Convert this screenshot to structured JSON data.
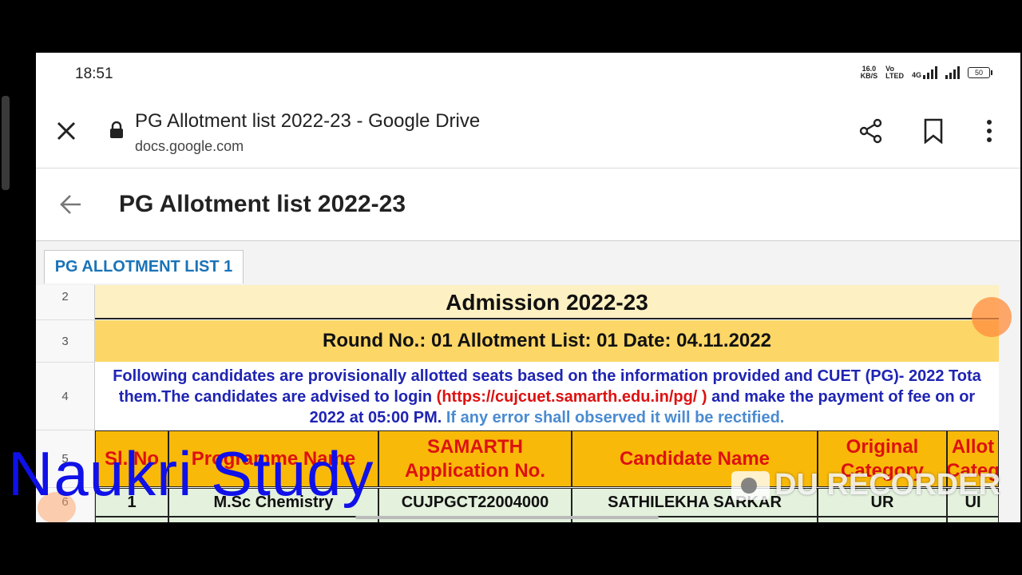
{
  "status_bar": {
    "time": "18:51",
    "speed_value": "16.0",
    "speed_unit": "KB/S",
    "volte_top": "Vo",
    "volte_bottom": "LTED",
    "network": "4G",
    "battery": "50"
  },
  "toolbar": {
    "title": "PG Allotment list 2022-23 - Google Drive",
    "url": "docs.google.com",
    "icons": [
      "close-icon",
      "lock-icon",
      "share-icon",
      "bookmark-icon",
      "more-vert-icon"
    ]
  },
  "doc_header": {
    "title": "PG Allotment list 2022-23",
    "back_icon": "arrow-back-icon"
  },
  "sheet": {
    "tab_label": "PG ALLOTMENT LIST 1",
    "row_numbers": [
      "2",
      "3",
      "4",
      "5",
      "6"
    ],
    "admission": "Admission 2022-23",
    "round": "Round No.: 01 Allotment List: 01 Date: 04.11.2022",
    "notice_line1": "Following candidates are provisionally allotted seats based on the information provided and CUET (PG)- 2022 Tota",
    "notice_line2_a": "them.The candidates are advised to login",
    "notice_line2_link": "(https://cujcuet.samarth.edu.in/pg/ )",
    "notice_line2_b": "and make the payment of fee on or",
    "notice_line3_a": "2022 at 05:00 PM.",
    "notice_line3_b": "If any error shall observed it will be rectified.",
    "headers": [
      "Sl. No",
      "Programme Name",
      "SAMARTH Application No.",
      "Candidate Name",
      "Original Category",
      "Allot Categ"
    ],
    "rows": [
      [
        "1",
        "M.Sc Chemistry",
        "CUJPGCT22004000",
        "SATHILEKHA SARKAR",
        "UR",
        "UI"
      ]
    ]
  },
  "overlays": {
    "watermark": "Naukri Study",
    "recorder": "DU RECORDER"
  },
  "colors": {
    "admission_bg": "#fdf0c2",
    "round_bg": "#fcd667",
    "header_bg": "#f9b908",
    "header_text": "#d11111",
    "data_row_bg": "#e3f1dd",
    "notice_blue": "#1f24b3",
    "link_red": "#d11111",
    "tab_text": "#1a73b8"
  }
}
